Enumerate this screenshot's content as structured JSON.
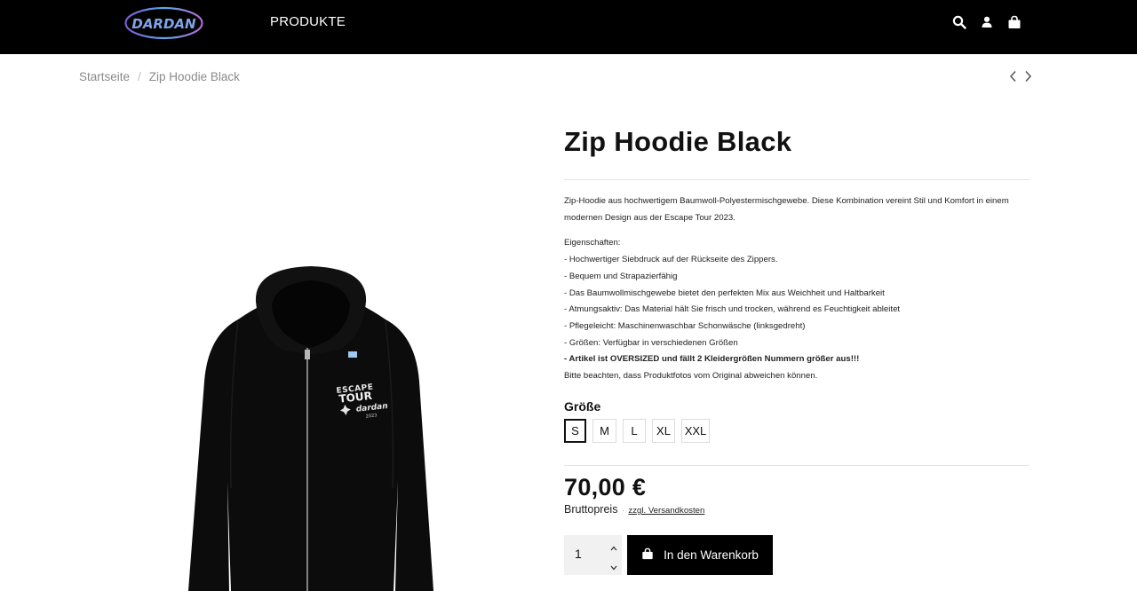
{
  "header": {
    "logo_text": "DARDAN",
    "nav": [
      {
        "label": "PRODUKTE"
      }
    ],
    "icons": [
      "search-icon",
      "user-icon",
      "shopping-bag-icon"
    ],
    "background": "#000000"
  },
  "breadcrumb": {
    "items": [
      {
        "label": "Startseite"
      },
      {
        "label": "Zip Hoodie Black"
      }
    ],
    "separator": "/"
  },
  "pager": {
    "prev_icon": "chevron-left-icon",
    "next_icon": "chevron-right-icon"
  },
  "product": {
    "title": "Zip Hoodie Black",
    "image": {
      "print_line1": "ESCAPE",
      "print_line2": "TOUR",
      "print_line3": "dardan",
      "print_line4": "2023"
    },
    "description": {
      "intro": [
        "Zip-Hoodie aus hochwertigem Baumwoll-Polyestermischgewebe. Diese Kombination vereint Stil und Komfort in einem",
        "modernen Design aus der Escape Tour 2023."
      ],
      "features_heading": "Eigenschaften:",
      "features": [
        "- Hochwertiger Siebdruck auf der Rückseite des Zippers.",
        "- Bequem und Strapazierfähig",
        "- Das Baumwollmischgewebe bietet den perfekten Mix aus Weichheit und Haltbarkeit",
        "- Atmungsaktiv: Das Material hält Sie frisch und trocken, während es Feuchtigkeit ableitet",
        "- Pflegeleicht: Maschinenwaschbar Schonwäsche (linksgedreht)",
        "- Größen: Verfügbar in verschiedenen Größen"
      ],
      "note_bold": "- Artikel ist OVERSIZED und fällt 2 Kleidergrößen Nummern größer aus!!!",
      "disclaimer": "Bitte beachten, dass Produktfotos vom Original abweichen können."
    },
    "size_label": "Größe",
    "sizes": [
      {
        "label": "S",
        "selected": true
      },
      {
        "label": "M",
        "selected": false
      },
      {
        "label": "L",
        "selected": false
      },
      {
        "label": "XL",
        "selected": false
      },
      {
        "label": "XXL",
        "selected": false
      }
    ],
    "price": "70,00 €",
    "price_note": "Bruttopreis",
    "shipping_link": "zzgl. Versandkosten",
    "quantity": "1",
    "add_to_cart": "In den Warenkorb"
  },
  "colors": {
    "accent": "#000000",
    "rule": "#e3e3e3",
    "muted": "#8a8a8a"
  }
}
